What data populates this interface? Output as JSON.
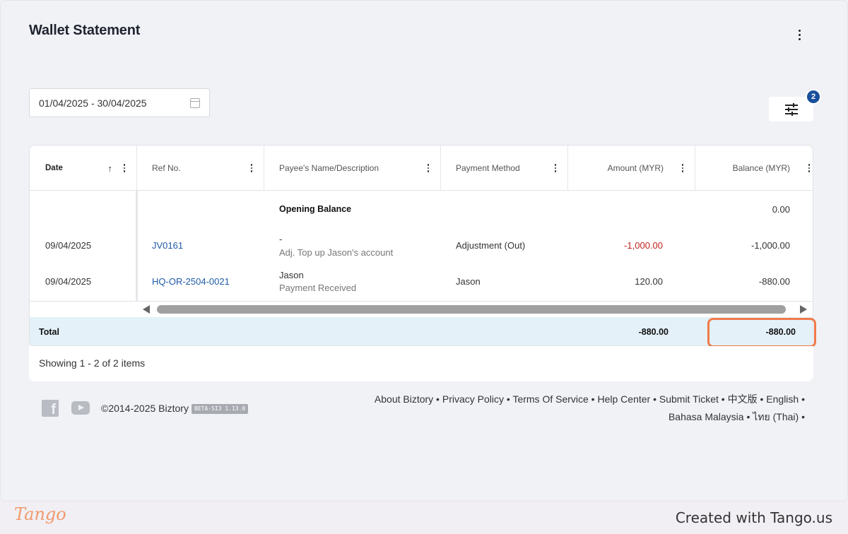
{
  "page": {
    "title": "Wallet Statement"
  },
  "filters": {
    "date_range": "01/04/2025 - 30/04/2025",
    "filter_count": "2"
  },
  "table": {
    "columns": [
      {
        "label": "Date",
        "sort": "ascending"
      },
      {
        "label": "Ref No."
      },
      {
        "label": "Payee's Name/Description"
      },
      {
        "label": "Payment Method"
      },
      {
        "label": "Amount (MYR)"
      },
      {
        "label": "Balance (MYR)"
      }
    ],
    "opening": {
      "label": "Opening Balance",
      "balance": "0.00"
    },
    "rows": [
      {
        "date": "09/04/2025",
        "ref": "JV0161",
        "payee": "-",
        "description": "Adj. Top up Jason's account",
        "method": "Adjustment (Out)",
        "amount": "-1,000.00",
        "balance": "-1,000.00"
      },
      {
        "date": "09/04/2025",
        "ref": "HQ-OR-2504-0021",
        "payee": "Jason",
        "description": "Payment Received",
        "method": "Jason",
        "amount": "120.00",
        "balance": "-880.00"
      }
    ],
    "total": {
      "label": "Total",
      "amount": "-880.00",
      "balance": "-880.00"
    },
    "showing": "Showing 1 - 2 of 2 items"
  },
  "footer": {
    "copyright": "©2014-2025 Biztory",
    "version": "BETA-SI3 1.13.0",
    "links": [
      "About Biztory",
      "Privacy Policy",
      "Terms Of Service",
      "Help Center",
      "Submit Ticket",
      "中文版",
      "English",
      "Bahasa Malaysia",
      "ไทย (Thai)"
    ],
    "icons": [
      "facebook-icon",
      "youtube-icon"
    ]
  },
  "watermark": {
    "logo": "Tango",
    "credit": "Created with Tango.us"
  },
  "colors": {
    "accent": "#1a4f9c",
    "link": "#1f5aa6",
    "negative": "#c0231f",
    "total_bg": "#e4f1f8",
    "highlight": "#f07b4a"
  }
}
